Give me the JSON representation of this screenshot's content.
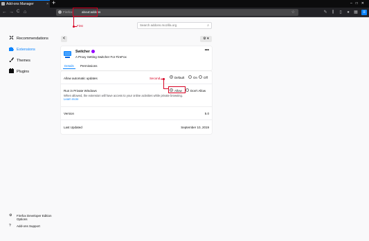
{
  "window": {
    "tab_title": "Add-ons Manager",
    "new_tab_symbol": "+",
    "tab_close_symbol": "×"
  },
  "toolbar": {
    "back_symbol": "←",
    "forward_symbol": "→",
    "reload_symbol": "C",
    "home_symbol": "⌂",
    "url_brand": "Firefox",
    "url_text": "about:addons",
    "bookmark_star": "☆"
  },
  "annotations": {
    "first_label": "First",
    "second_label": "Second",
    "color": "#d70022"
  },
  "sidebar": {
    "items": [
      {
        "label": "Recommendations",
        "icon": "recommendations-icon"
      },
      {
        "label": "Extensions",
        "icon": "extensions-puzzle-icon",
        "selected": true
      },
      {
        "label": "Themes",
        "icon": "themes-brush-icon"
      },
      {
        "label": "Plugins",
        "icon": "plugins-block-icon"
      }
    ],
    "footer": {
      "options_line1": "Firefox Developer Edition",
      "options_line2": "Options",
      "support": "Add-ons Support"
    }
  },
  "main": {
    "search_placeholder": "Search addons.mozilla.org",
    "back_symbol": "<",
    "gear_label": "⚙ ▾",
    "addon": {
      "name": "Switcher",
      "description": "A Proxy Setting Switcher For FireFox",
      "more_symbol": "•••",
      "tabs": [
        "Details",
        "Permissions"
      ]
    },
    "details": {
      "auto_updates_label": "Allow automatic updates",
      "auto_updates_options": [
        "Default",
        "On",
        "Off"
      ],
      "auto_updates_selected": "Default",
      "private_label": "Run in Private Windows",
      "private_options": [
        "Allow",
        "Don't Allow"
      ],
      "private_selected": "Allow",
      "private_note": "When allowed, the extension will have access to your online activities while private browsing.",
      "learn_more": "Learn more",
      "version_label": "Version",
      "version_value": "5.0",
      "last_updated_label": "Last Updated",
      "last_updated_value": "September 10, 2019"
    }
  },
  "colors": {
    "accent": "#0a84ff",
    "toolbar_dark": "#232327",
    "recommended_badge": "#9400ff"
  }
}
